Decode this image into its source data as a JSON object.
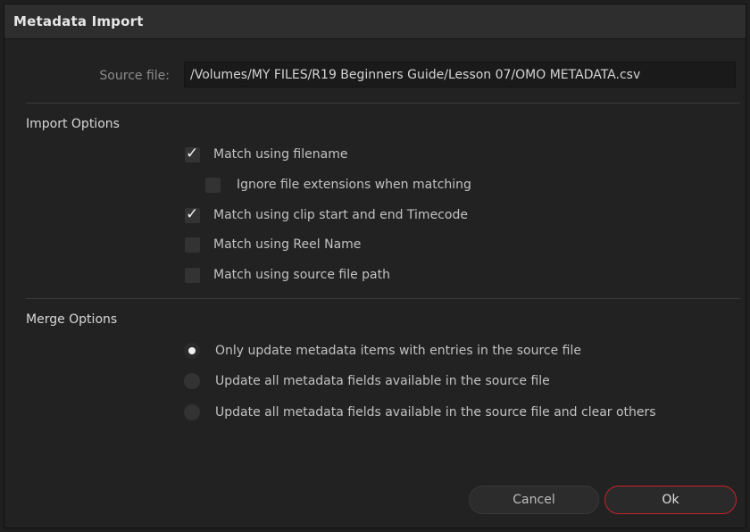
{
  "dialog": {
    "title": "Metadata Import"
  },
  "source": {
    "label": "Source file:",
    "value": "/Volumes/MY FILES/R19 Beginners Guide/Lesson 07/OMO METADATA.csv"
  },
  "import_options": {
    "title": "Import Options",
    "items": [
      {
        "label": "Match using filename",
        "checked": true
      },
      {
        "label": "Ignore file extensions when matching",
        "checked": false
      },
      {
        "label": "Match using clip start and end Timecode",
        "checked": true
      },
      {
        "label": "Match using Reel Name",
        "checked": false
      },
      {
        "label": "Match using source file path",
        "checked": false
      }
    ]
  },
  "merge_options": {
    "title": "Merge Options",
    "items": [
      {
        "label": "Only update metadata items with entries in the source file",
        "selected": true
      },
      {
        "label": "Update all metadata fields available in the source file",
        "selected": false
      },
      {
        "label": "Update all metadata fields available in the source file and clear others",
        "selected": false
      }
    ]
  },
  "buttons": {
    "cancel": "Cancel",
    "ok": "Ok"
  },
  "colors": {
    "ok_border": "#c8232a",
    "background": "#222222"
  }
}
